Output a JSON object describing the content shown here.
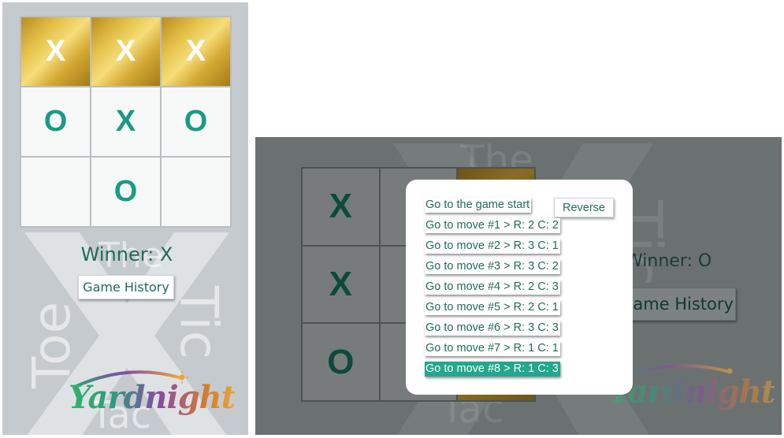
{
  "left_view": {
    "board": [
      {
        "mark": "X",
        "winning": true
      },
      {
        "mark": "X",
        "winning": true
      },
      {
        "mark": "X",
        "winning": true
      },
      {
        "mark": "O",
        "winning": false
      },
      {
        "mark": "X",
        "winning": false
      },
      {
        "mark": "O",
        "winning": false
      },
      {
        "mark": "",
        "winning": false
      },
      {
        "mark": "O",
        "winning": false
      },
      {
        "mark": "",
        "winning": false
      }
    ],
    "status": "Winner: X",
    "history_button": "Game History"
  },
  "right_view": {
    "board_visible": [
      "X",
      "",
      "",
      "X",
      "",
      "",
      "O",
      "",
      ""
    ],
    "status": "Winner: O",
    "history_button": "Game History"
  },
  "background_words": {
    "the": "The",
    "toe": "Toe",
    "tic": "Tic",
    "tac": "Tac"
  },
  "logo": {
    "text": "Yardnight"
  },
  "history_modal": {
    "reverse_label": "Reverse",
    "moves": [
      "Go to the game start",
      "Go to move #1 > R: 2 C: 2",
      "Go to move #2 > R: 3 C: 1",
      "Go to move #3 > R: 3 C: 2",
      "Go to move #4 > R: 2 C: 3",
      "Go to move #5 > R: 2 C: 1",
      "Go to move #6 > R: 3 C: 3",
      "Go to move #7 > R: 1 C: 1",
      "Go to move #8 > R: 1 C: 3"
    ],
    "current_move": 8
  },
  "colors": {
    "accent": "#1a9b84",
    "text_dark_green": "#1f6b5a",
    "current_move_bg": "#21a88e",
    "panel_bg": "#c5cacf",
    "overlay_bg": "#6b7171"
  }
}
